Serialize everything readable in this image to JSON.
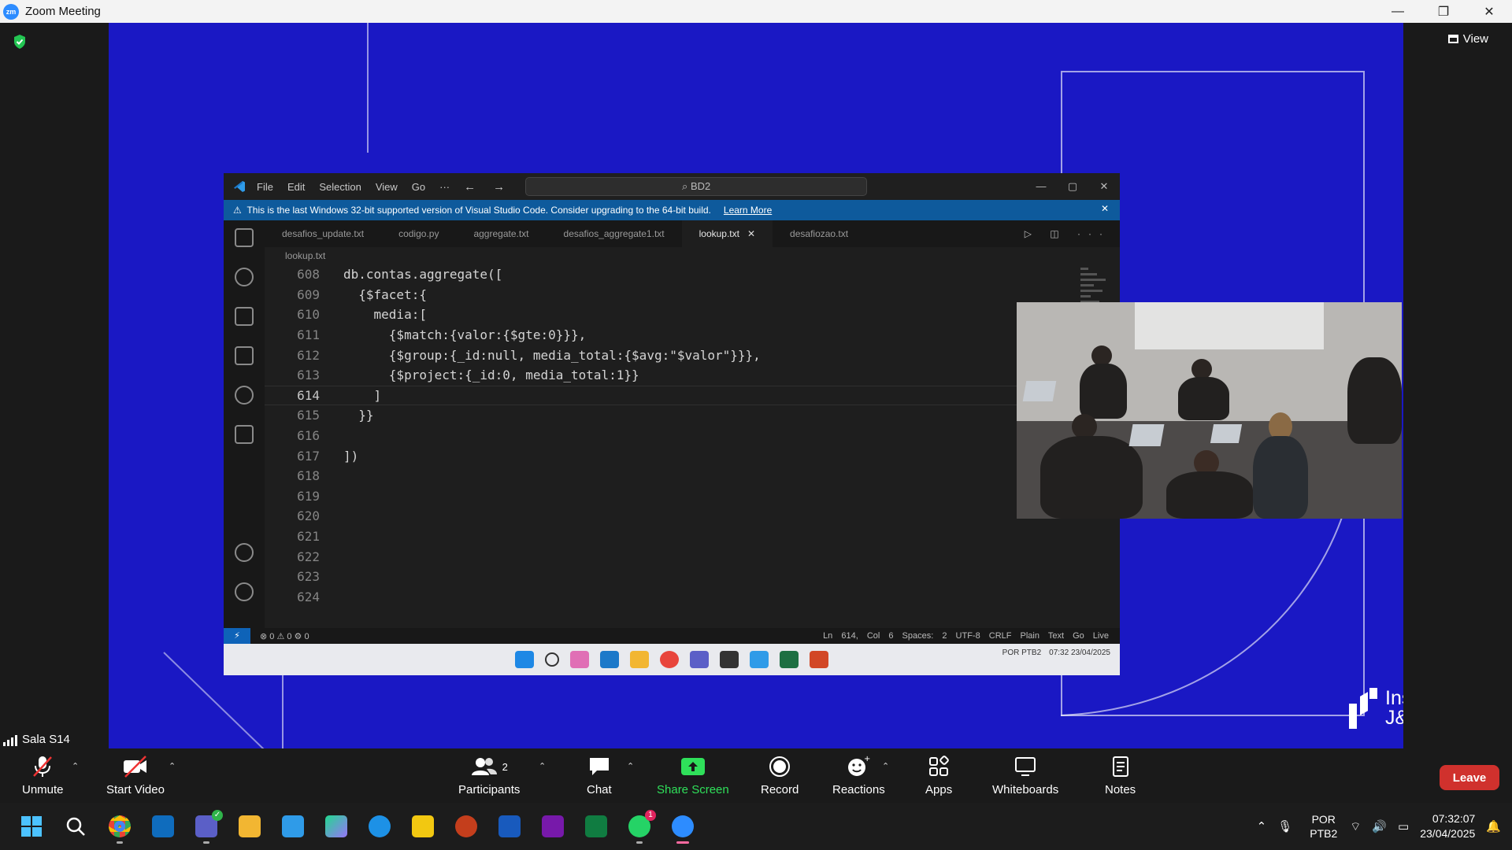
{
  "window": {
    "title": "Zoom Meeting",
    "logo_text": "zm",
    "minimize": "—",
    "maximize": "❐",
    "close": "✕"
  },
  "meeting": {
    "view_label": "View",
    "room_name": "Sala S14"
  },
  "vscode": {
    "menu": [
      "File",
      "Edit",
      "Selection",
      "View",
      "Go",
      "···"
    ],
    "search_text": "BD2",
    "banner_text": "This is the last Windows 32-bit supported version of Visual Studio Code. Consider upgrading to the 64-bit build.",
    "banner_link": "Learn More",
    "tabs": [
      "desafios_update.txt",
      "codigo.py",
      "aggregate.txt",
      "desafios_aggregate1.txt",
      "lookup.txt",
      "desafiozao.txt"
    ],
    "active_tab_index": 4,
    "breadcrumb": "lookup.txt",
    "code_lines": [
      {
        "n": "608",
        "t": "db.contas.aggregate(["
      },
      {
        "n": "609",
        "t": "  {$facet:{"
      },
      {
        "n": "610",
        "t": "    media:["
      },
      {
        "n": "611",
        "t": "      {$match:{valor:{$gte:0}}},"
      },
      {
        "n": "612",
        "t": "      {$group:{_id:null, media_total:{$avg:\"$valor\"}}},"
      },
      {
        "n": "613",
        "t": "      {$project:{_id:0, media_total:1}}"
      },
      {
        "n": "614",
        "t": "    ]"
      },
      {
        "n": "615",
        "t": "  }}"
      },
      {
        "n": "616",
        "t": ""
      },
      {
        "n": "617",
        "t": "])"
      },
      {
        "n": "618",
        "t": ""
      },
      {
        "n": "619",
        "t": ""
      },
      {
        "n": "620",
        "t": ""
      },
      {
        "n": "621",
        "t": ""
      },
      {
        "n": "622",
        "t": ""
      },
      {
        "n": "623",
        "t": ""
      },
      {
        "n": "624",
        "t": ""
      }
    ],
    "current_line": "614",
    "status_left": "⊗ 0 ⚠ 0   ⚙ 0",
    "status_right": "Ln 614, Col 6  Spaces: 2  UTF-8  CRLF  Plain Text  Go Live",
    "inner_tray_lang": "POR PTB2",
    "inner_tray_time": "07:32 23/04/2025"
  },
  "slide": {
    "logo_line1": "Instituto",
    "logo_line2": "J&F"
  },
  "toolbar": {
    "unmute": "Unmute",
    "start_video": "Start Video",
    "participants": "Participants",
    "participants_count": "2",
    "chat": "Chat",
    "share_screen": "Share Screen",
    "record": "Record",
    "reactions": "Reactions",
    "apps": "Apps",
    "whiteboards": "Whiteboards",
    "notes": "Notes",
    "leave": "Leave"
  },
  "taskbar": {
    "whatsapp_badge": "1",
    "lang_line1": "POR",
    "lang_line2": "PTB2",
    "time": "07:32:07",
    "date": "23/04/2025"
  },
  "colors": {
    "slide_blue": "#1a18c4",
    "zoom_blue": "#2D8CFF",
    "leave_red": "#d0312d",
    "share_green": "#2fe05a"
  }
}
